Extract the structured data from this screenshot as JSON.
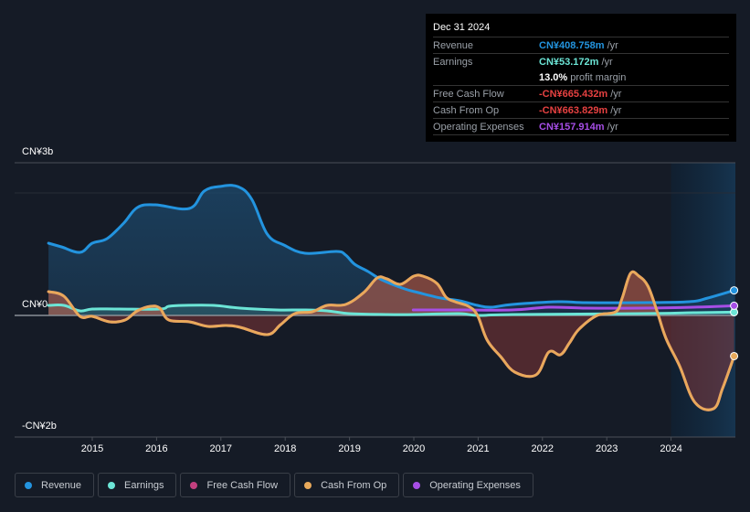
{
  "tooltip": {
    "date": "Dec 31 2024",
    "rows": [
      {
        "label": "Revenue",
        "value": "CN¥408.758m",
        "unit": "/yr",
        "color": "#2394df"
      },
      {
        "label": "Earnings",
        "value": "CN¥53.172m",
        "unit": "/yr",
        "color": "#6ce5d6"
      },
      {
        "label": "",
        "value": "13.0%",
        "unit": "profit margin",
        "color": "#ffffff"
      },
      {
        "label": "Free Cash Flow",
        "value": "-CN¥665.432m",
        "unit": "/yr",
        "color": "#e64141"
      },
      {
        "label": "Cash From Op",
        "value": "-CN¥663.829m",
        "unit": "/yr",
        "color": "#e64141"
      },
      {
        "label": "Operating Expenses",
        "value": "CN¥157.914m",
        "unit": "/yr",
        "color": "#a64ee6"
      }
    ]
  },
  "chart_data": {
    "type": "area",
    "title": "",
    "xlabel": "",
    "ylabel": "",
    "y_tick_labels": [
      "CN¥3b",
      "CN¥0",
      "-CN¥2b"
    ],
    "x_tick_labels": [
      "2015",
      "2016",
      "2017",
      "2018",
      "2019",
      "2020",
      "2021",
      "2022",
      "2023",
      "2024"
    ],
    "x_ticks": [
      2015,
      2016,
      2017,
      2018,
      2019,
      2020,
      2021,
      2022,
      2023,
      2024
    ],
    "xlim": [
      2014.6,
      2025.0
    ],
    "ylim_millions": [
      -2000,
      2500
    ],
    "highlight_from": 2024.0,
    "legend_position": "bottom-left",
    "series": [
      {
        "name": "Revenue",
        "color": "#2394df",
        "fill": true,
        "points": [
          [
            2014.32,
            1179
          ],
          [
            2014.52,
            1119
          ],
          [
            2014.81,
            1030
          ],
          [
            2015.0,
            1179
          ],
          [
            2015.23,
            1254
          ],
          [
            2015.49,
            1507
          ],
          [
            2015.7,
            1761
          ],
          [
            2015.98,
            1806
          ],
          [
            2016.51,
            1746
          ],
          [
            2016.74,
            2030
          ],
          [
            2016.98,
            2104
          ],
          [
            2017.26,
            2104
          ],
          [
            2017.48,
            1896
          ],
          [
            2017.72,
            1328
          ],
          [
            2017.98,
            1149
          ],
          [
            2018.31,
            1015
          ],
          [
            2018.8,
            1045
          ],
          [
            2018.94,
            985
          ],
          [
            2019.08,
            836
          ],
          [
            2019.29,
            716
          ],
          [
            2019.5,
            582
          ],
          [
            2019.86,
            433
          ],
          [
            2020.07,
            373
          ],
          [
            2020.42,
            284
          ],
          [
            2020.71,
            239
          ],
          [
            2020.99,
            164
          ],
          [
            2021.2,
            134
          ],
          [
            2021.53,
            179
          ],
          [
            2022.24,
            224
          ],
          [
            2022.67,
            209
          ],
          [
            2023.53,
            209
          ],
          [
            2024.28,
            224
          ],
          [
            2024.57,
            284
          ],
          [
            2024.98,
            409
          ]
        ]
      },
      {
        "name": "Earnings",
        "color": "#6ce5d6",
        "fill": true,
        "points": [
          [
            2014.32,
            164
          ],
          [
            2014.56,
            164
          ],
          [
            2014.81,
            75
          ],
          [
            2015.0,
            104
          ],
          [
            2015.41,
            104
          ],
          [
            2016.05,
            104
          ],
          [
            2016.19,
            149
          ],
          [
            2016.42,
            164
          ],
          [
            2016.89,
            164
          ],
          [
            2017.3,
            119
          ],
          [
            2017.87,
            90
          ],
          [
            2018.3,
            90
          ],
          [
            2018.65,
            75
          ],
          [
            2019.0,
            30
          ],
          [
            2019.59,
            15
          ],
          [
            2020.02,
            15
          ],
          [
            2020.7,
            30
          ],
          [
            2020.99,
            0
          ],
          [
            2021.53,
            15
          ],
          [
            2023.53,
            30
          ],
          [
            2024.35,
            45
          ],
          [
            2024.98,
            53
          ]
        ]
      },
      {
        "name": "Free Cash Flow",
        "color": "#c2407f",
        "fill": false,
        "points": [
          [
            2014.32,
            388
          ],
          [
            2014.56,
            313
          ],
          [
            2014.81,
            -15
          ],
          [
            2015.0,
            -15
          ],
          [
            2015.27,
            -104
          ],
          [
            2015.51,
            -75
          ],
          [
            2015.7,
            75
          ],
          [
            2015.91,
            149
          ],
          [
            2016.05,
            119
          ],
          [
            2016.19,
            -75
          ],
          [
            2016.51,
            -104
          ],
          [
            2016.8,
            -179
          ],
          [
            2017.08,
            -164
          ],
          [
            2017.3,
            -194
          ],
          [
            2017.72,
            -313
          ],
          [
            2017.93,
            -149
          ],
          [
            2018.15,
            30
          ],
          [
            2018.42,
            60
          ],
          [
            2018.65,
            164
          ],
          [
            2018.94,
            179
          ],
          [
            2019.22,
            373
          ],
          [
            2019.43,
            612
          ],
          [
            2019.58,
            597
          ],
          [
            2019.79,
            507
          ],
          [
            2020.0,
            642
          ],
          [
            2020.14,
            642
          ],
          [
            2020.36,
            522
          ],
          [
            2020.5,
            299
          ],
          [
            2020.64,
            224
          ],
          [
            2020.85,
            149
          ],
          [
            2020.99,
            0
          ],
          [
            2021.14,
            -403
          ],
          [
            2021.35,
            -672
          ],
          [
            2021.57,
            -925
          ],
          [
            2021.9,
            -970
          ],
          [
            2022.1,
            -597
          ],
          [
            2022.28,
            -642
          ],
          [
            2022.42,
            -448
          ],
          [
            2022.57,
            -224
          ],
          [
            2022.85,
            0
          ],
          [
            2023.14,
            60
          ],
          [
            2023.24,
            284
          ],
          [
            2023.37,
            687
          ],
          [
            2023.5,
            642
          ],
          [
            2023.64,
            478
          ],
          [
            2023.78,
            75
          ],
          [
            2023.92,
            -373
          ],
          [
            2024.13,
            -821
          ],
          [
            2024.37,
            -1418
          ],
          [
            2024.66,
            -1522
          ],
          [
            2024.8,
            -1194
          ],
          [
            2024.98,
            -665
          ]
        ]
      },
      {
        "name": "Cash From Op",
        "color": "#e8a95b",
        "fill": true,
        "points": [
          [
            2014.32,
            388
          ],
          [
            2014.56,
            313
          ],
          [
            2014.81,
            -15
          ],
          [
            2015.0,
            -15
          ],
          [
            2015.27,
            -104
          ],
          [
            2015.51,
            -75
          ],
          [
            2015.7,
            75
          ],
          [
            2015.91,
            149
          ],
          [
            2016.05,
            119
          ],
          [
            2016.19,
            -75
          ],
          [
            2016.51,
            -104
          ],
          [
            2016.8,
            -179
          ],
          [
            2017.08,
            -164
          ],
          [
            2017.3,
            -194
          ],
          [
            2017.72,
            -313
          ],
          [
            2017.93,
            -149
          ],
          [
            2018.15,
            30
          ],
          [
            2018.42,
            60
          ],
          [
            2018.65,
            164
          ],
          [
            2018.94,
            179
          ],
          [
            2019.22,
            373
          ],
          [
            2019.43,
            612
          ],
          [
            2019.58,
            597
          ],
          [
            2019.79,
            507
          ],
          [
            2020.0,
            642
          ],
          [
            2020.14,
            642
          ],
          [
            2020.36,
            522
          ],
          [
            2020.5,
            299
          ],
          [
            2020.64,
            224
          ],
          [
            2020.85,
            149
          ],
          [
            2020.99,
            0
          ],
          [
            2021.14,
            -403
          ],
          [
            2021.35,
            -672
          ],
          [
            2021.57,
            -925
          ],
          [
            2021.9,
            -970
          ],
          [
            2022.1,
            -597
          ],
          [
            2022.28,
            -642
          ],
          [
            2022.42,
            -448
          ],
          [
            2022.57,
            -224
          ],
          [
            2022.85,
            0
          ],
          [
            2023.14,
            60
          ],
          [
            2023.24,
            284
          ],
          [
            2023.37,
            687
          ],
          [
            2023.5,
            642
          ],
          [
            2023.64,
            478
          ],
          [
            2023.78,
            75
          ],
          [
            2023.92,
            -373
          ],
          [
            2024.13,
            -821
          ],
          [
            2024.37,
            -1418
          ],
          [
            2024.66,
            -1522
          ],
          [
            2024.8,
            -1194
          ],
          [
            2024.98,
            -664
          ]
        ]
      },
      {
        "name": "Operating Expenses",
        "color": "#a64ee6",
        "fill": false,
        "points": [
          [
            2019.99,
            90
          ],
          [
            2020.71,
            90
          ],
          [
            2021.53,
            90
          ],
          [
            2022.1,
            134
          ],
          [
            2022.67,
            119
          ],
          [
            2023.53,
            119
          ],
          [
            2024.35,
            134
          ],
          [
            2024.98,
            158
          ]
        ]
      }
    ]
  },
  "legend": [
    {
      "label": "Revenue",
      "color": "#2394df"
    },
    {
      "label": "Earnings",
      "color": "#6ce5d6"
    },
    {
      "label": "Free Cash Flow",
      "color": "#c2407f"
    },
    {
      "label": "Cash From Op",
      "color": "#e8a95b"
    },
    {
      "label": "Operating Expenses",
      "color": "#a64ee6"
    }
  ]
}
